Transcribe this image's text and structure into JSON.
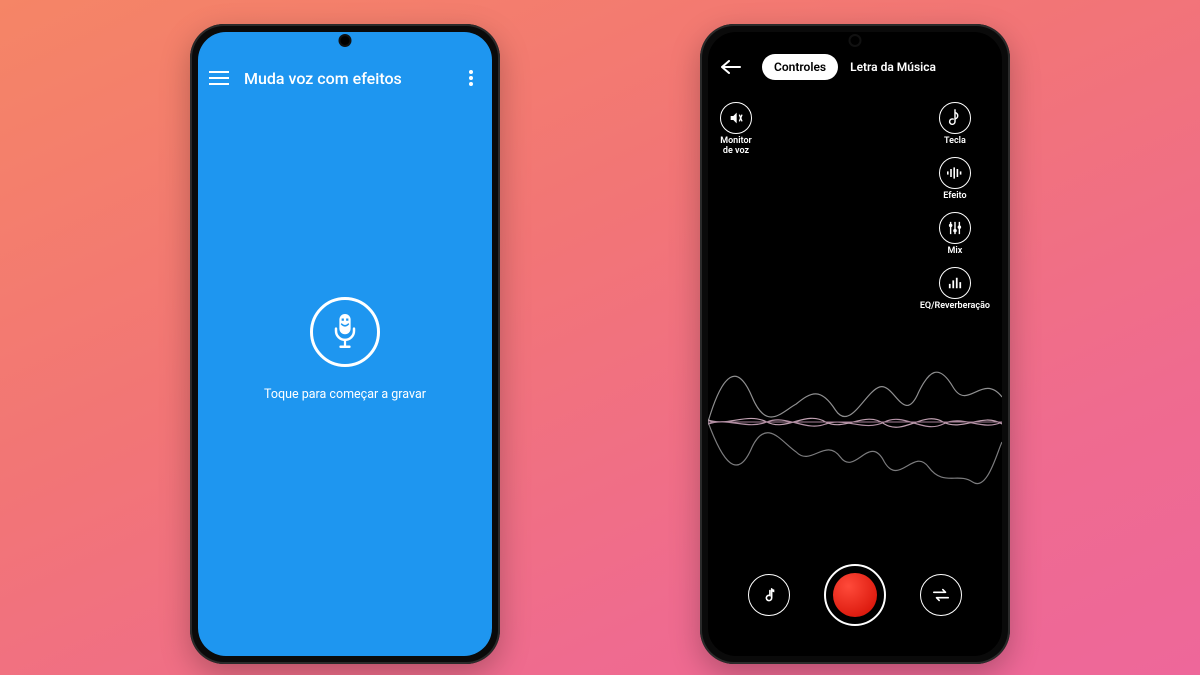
{
  "left_phone": {
    "app_title": "Muda voz com efeitos",
    "instruction": "Toque para começar a gravar"
  },
  "right_phone": {
    "tabs": {
      "controls": "Controles",
      "lyrics": "Letra da Música"
    },
    "controls_left": {
      "monitor": "Monitor\nde voz"
    },
    "controls_right": {
      "key": "Tecla",
      "effect": "Efeito",
      "mix": "Mix",
      "eq": "EQ/Reverberação"
    }
  }
}
